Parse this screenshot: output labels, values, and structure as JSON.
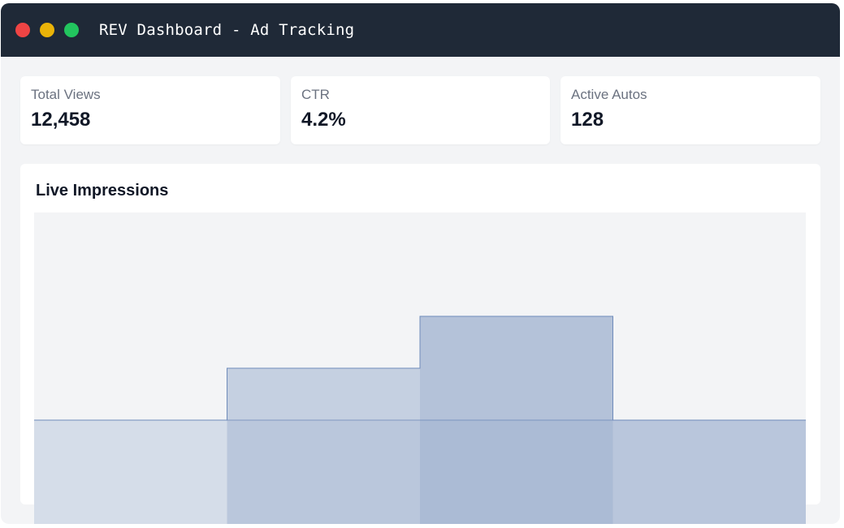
{
  "window": {
    "title": "REV Dashboard - Ad Tracking",
    "colors": {
      "titlebar": "#1f2937",
      "close": "#ef4444",
      "minimize": "#eab308",
      "maximize": "#22c55e"
    }
  },
  "stats": [
    {
      "label": "Total Views",
      "value": "12,458"
    },
    {
      "label": "CTR",
      "value": "4.2%"
    },
    {
      "label": "Active Autos",
      "value": "128"
    }
  ],
  "panel": {
    "title": "Live Impressions"
  },
  "chart_data": {
    "type": "area",
    "title": "Live Impressions",
    "step": true,
    "x": [
      0,
      1,
      2,
      3
    ],
    "series": [
      {
        "values": [
          2,
          3,
          4,
          2
        ],
        "color": "#6f8bba"
      }
    ],
    "ylim": [
      0,
      6
    ],
    "grid": false,
    "background": "#f3f4f6"
  }
}
